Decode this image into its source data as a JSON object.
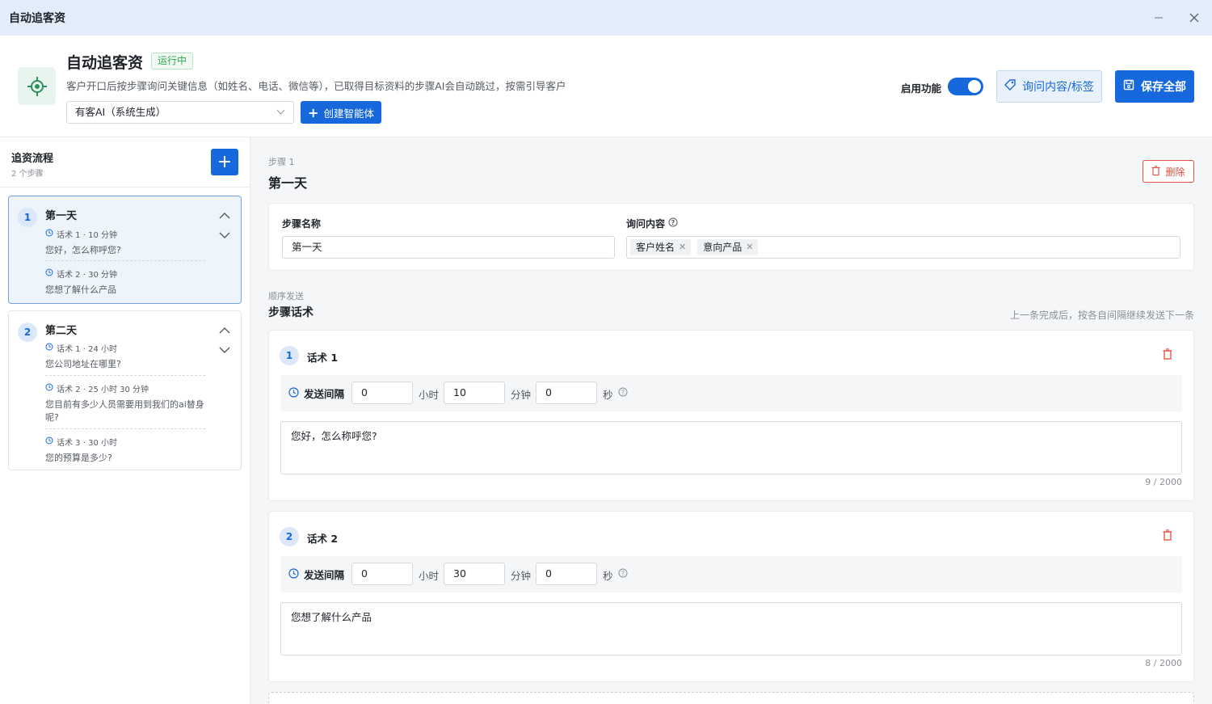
{
  "window": {
    "title": "自动追客资"
  },
  "header": {
    "title": "自动追客资",
    "status_badge": "运行中",
    "description": "客户开口后按步骤询问关键信息（如姓名、电话、微信等），已取得目标资料的步骤AI会自动跳过，按需引导客户",
    "agent_select": "有客AI（系统生成）",
    "create_agent_label": "创建智能体",
    "toggle_label": "启用功能",
    "toggle_on": true,
    "tag_button_label": "询问内容/标签",
    "save_button_label": "保存全部"
  },
  "sidebar": {
    "title": "追资流程",
    "subtitle": "2 个步骤",
    "steps": [
      {
        "num": "1",
        "name": "第一天",
        "messages": [
          {
            "meta": "话术 1 · 10 分钟",
            "text": "您好，怎么称呼您?"
          },
          {
            "meta": "话术 2 · 30 分钟",
            "text": "您想了解什么产品"
          }
        ]
      },
      {
        "num": "2",
        "name": "第二天",
        "messages": [
          {
            "meta": "话术 1 · 24 小时",
            "text": "您公司地址在哪里?"
          },
          {
            "meta": "话术 2 · 25 小时 30 分钟",
            "text": "您目前有多少人员需要用到我们的ai替身呢?"
          },
          {
            "meta": "话术 3 · 30 小时",
            "text": "您的预算是多少?"
          }
        ]
      }
    ]
  },
  "main": {
    "step_label": "步骤 1",
    "step_title": "第一天",
    "delete_label": "删除",
    "step_name_label": "步骤名称",
    "step_name_value": "第一天",
    "ask_content_label": "询问内容",
    "ask_tags": [
      "客户姓名",
      "意向产品"
    ],
    "seq_label": "顺序发送",
    "scripts_title": "步骤话术",
    "seq_note": "上一条完成后，按各自间隔继续发送下一条",
    "scripts": [
      {
        "num": "1",
        "title": "话术 1",
        "interval_label": "发送间隔",
        "hours": "0",
        "minutes": "10",
        "seconds": "0",
        "content": "您好，怎么称呼您?",
        "count": "9 / 2000"
      },
      {
        "num": "2",
        "title": "话术 2",
        "interval_label": "发送间隔",
        "hours": "0",
        "minutes": "30",
        "seconds": "0",
        "content": "您想了解什么产品",
        "count": "8 / 2000"
      }
    ],
    "unit_hour": "小时",
    "unit_minute": "分钟",
    "unit_second": "秒"
  },
  "colors": {
    "primary": "#1668dc",
    "success": "#2ea44f",
    "danger": "#e74c3c"
  }
}
